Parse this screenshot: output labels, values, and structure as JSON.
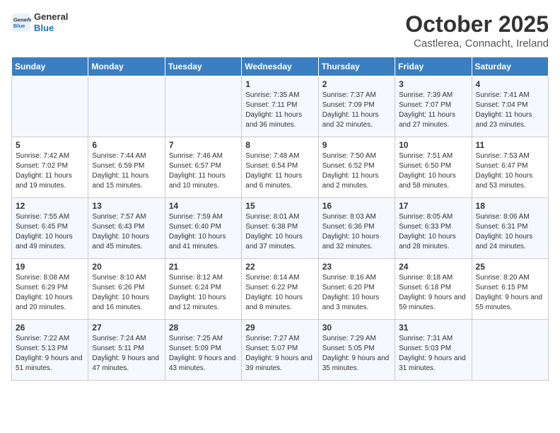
{
  "header": {
    "logo_line1": "General",
    "logo_line2": "Blue",
    "month": "October 2025",
    "location": "Castlerea, Connacht, Ireland"
  },
  "days_of_week": [
    "Sunday",
    "Monday",
    "Tuesday",
    "Wednesday",
    "Thursday",
    "Friday",
    "Saturday"
  ],
  "weeks": [
    [
      {
        "day": "",
        "info": ""
      },
      {
        "day": "",
        "info": ""
      },
      {
        "day": "",
        "info": ""
      },
      {
        "day": "1",
        "info": "Sunrise: 7:35 AM\nSunset: 7:11 PM\nDaylight: 11 hours\nand 36 minutes."
      },
      {
        "day": "2",
        "info": "Sunrise: 7:37 AM\nSunset: 7:09 PM\nDaylight: 11 hours\nand 32 minutes."
      },
      {
        "day": "3",
        "info": "Sunrise: 7:39 AM\nSunset: 7:07 PM\nDaylight: 11 hours\nand 27 minutes."
      },
      {
        "day": "4",
        "info": "Sunrise: 7:41 AM\nSunset: 7:04 PM\nDaylight: 11 hours\nand 23 minutes."
      }
    ],
    [
      {
        "day": "5",
        "info": "Sunrise: 7:42 AM\nSunset: 7:02 PM\nDaylight: 11 hours\nand 19 minutes."
      },
      {
        "day": "6",
        "info": "Sunrise: 7:44 AM\nSunset: 6:59 PM\nDaylight: 11 hours\nand 15 minutes."
      },
      {
        "day": "7",
        "info": "Sunrise: 7:46 AM\nSunset: 6:57 PM\nDaylight: 11 hours\nand 10 minutes."
      },
      {
        "day": "8",
        "info": "Sunrise: 7:48 AM\nSunset: 6:54 PM\nDaylight: 11 hours\nand 6 minutes."
      },
      {
        "day": "9",
        "info": "Sunrise: 7:50 AM\nSunset: 6:52 PM\nDaylight: 11 hours\nand 2 minutes."
      },
      {
        "day": "10",
        "info": "Sunrise: 7:51 AM\nSunset: 6:50 PM\nDaylight: 10 hours\nand 58 minutes."
      },
      {
        "day": "11",
        "info": "Sunrise: 7:53 AM\nSunset: 6:47 PM\nDaylight: 10 hours\nand 53 minutes."
      }
    ],
    [
      {
        "day": "12",
        "info": "Sunrise: 7:55 AM\nSunset: 6:45 PM\nDaylight: 10 hours\nand 49 minutes."
      },
      {
        "day": "13",
        "info": "Sunrise: 7:57 AM\nSunset: 6:43 PM\nDaylight: 10 hours\nand 45 minutes."
      },
      {
        "day": "14",
        "info": "Sunrise: 7:59 AM\nSunset: 6:40 PM\nDaylight: 10 hours\nand 41 minutes."
      },
      {
        "day": "15",
        "info": "Sunrise: 8:01 AM\nSunset: 6:38 PM\nDaylight: 10 hours\nand 37 minutes."
      },
      {
        "day": "16",
        "info": "Sunrise: 8:03 AM\nSunset: 6:36 PM\nDaylight: 10 hours\nand 32 minutes."
      },
      {
        "day": "17",
        "info": "Sunrise: 8:05 AM\nSunset: 6:33 PM\nDaylight: 10 hours\nand 28 minutes."
      },
      {
        "day": "18",
        "info": "Sunrise: 8:06 AM\nSunset: 6:31 PM\nDaylight: 10 hours\nand 24 minutes."
      }
    ],
    [
      {
        "day": "19",
        "info": "Sunrise: 8:08 AM\nSunset: 6:29 PM\nDaylight: 10 hours\nand 20 minutes."
      },
      {
        "day": "20",
        "info": "Sunrise: 8:10 AM\nSunset: 6:26 PM\nDaylight: 10 hours\nand 16 minutes."
      },
      {
        "day": "21",
        "info": "Sunrise: 8:12 AM\nSunset: 6:24 PM\nDaylight: 10 hours\nand 12 minutes."
      },
      {
        "day": "22",
        "info": "Sunrise: 8:14 AM\nSunset: 6:22 PM\nDaylight: 10 hours\nand 8 minutes."
      },
      {
        "day": "23",
        "info": "Sunrise: 8:16 AM\nSunset: 6:20 PM\nDaylight: 10 hours\nand 3 minutes."
      },
      {
        "day": "24",
        "info": "Sunrise: 8:18 AM\nSunset: 6:18 PM\nDaylight: 9 hours\nand 59 minutes."
      },
      {
        "day": "25",
        "info": "Sunrise: 8:20 AM\nSunset: 6:15 PM\nDaylight: 9 hours\nand 55 minutes."
      }
    ],
    [
      {
        "day": "26",
        "info": "Sunrise: 7:22 AM\nSunset: 5:13 PM\nDaylight: 9 hours\nand 51 minutes."
      },
      {
        "day": "27",
        "info": "Sunrise: 7:24 AM\nSunset: 5:11 PM\nDaylight: 9 hours\nand 47 minutes."
      },
      {
        "day": "28",
        "info": "Sunrise: 7:25 AM\nSunset: 5:09 PM\nDaylight: 9 hours\nand 43 minutes."
      },
      {
        "day": "29",
        "info": "Sunrise: 7:27 AM\nSunset: 5:07 PM\nDaylight: 9 hours\nand 39 minutes."
      },
      {
        "day": "30",
        "info": "Sunrise: 7:29 AM\nSunset: 5:05 PM\nDaylight: 9 hours\nand 35 minutes."
      },
      {
        "day": "31",
        "info": "Sunrise: 7:31 AM\nSunset: 5:03 PM\nDaylight: 9 hours\nand 31 minutes."
      },
      {
        "day": "",
        "info": ""
      }
    ]
  ]
}
